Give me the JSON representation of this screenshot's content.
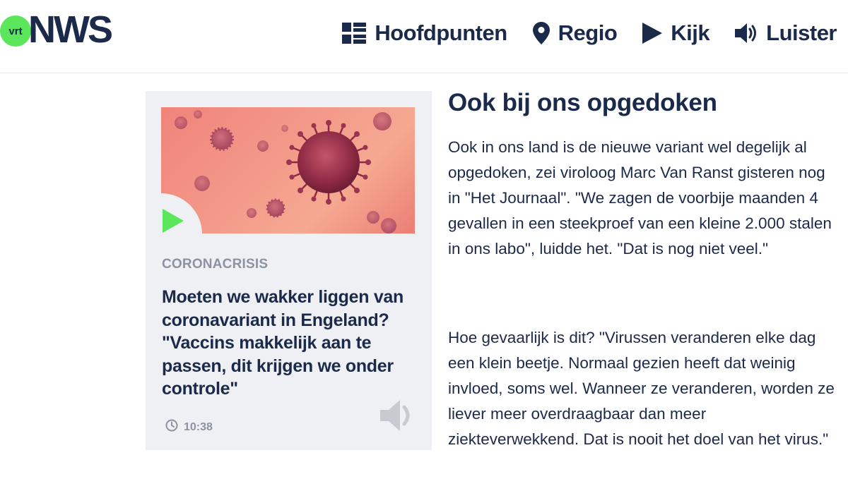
{
  "header": {
    "logo": {
      "badge": "vrt",
      "wordmark": "NWS"
    },
    "nav": [
      {
        "label": "Hoofdpunten",
        "icon": "grid-icon"
      },
      {
        "label": "Regio",
        "icon": "map-pin-icon"
      },
      {
        "label": "Kijk",
        "icon": "play-icon"
      },
      {
        "label": "Luister",
        "icon": "speaker-icon"
      }
    ]
  },
  "card": {
    "kicker": "CORONACRISIS",
    "title": "Moeten we wakker liggen van coronavariant in Engeland? \"Vaccins makkelijk aan te passen, dit krijgen we onder controle\"",
    "time": "10:38",
    "image": "coronavirus-illustration",
    "accent": "#5ce65c"
  },
  "article": {
    "heading": "Ook bij ons opgedoken",
    "paragraphs": [
      "Ook in ons land is de nieuwe variant wel degelijk al opgedoken, zei viroloog Marc Van Ranst gisteren nog in \"Het Journaal\". \"We zagen de voorbije maanden 4 gevallen in een steekproef van een kleine 2.000 stalen in ons labo\", luidde het. \"Dat is nog niet veel.\"",
      "Hoe gevaarlijk is dit? \"Virussen veranderen elke dag een klein beetje. Normaal gezien heeft dat weinig invloed, soms wel. Wanneer ze veranderen, worden ze liever meer overdraagbaar dan meer ziekteverwekkend. Dat is nooit het doel van het virus.\""
    ]
  },
  "colors": {
    "navy": "#1b2a4a",
    "brand_green": "#5ce65c",
    "muted": "#8b92a2",
    "card_bg": "#eff0f3"
  }
}
